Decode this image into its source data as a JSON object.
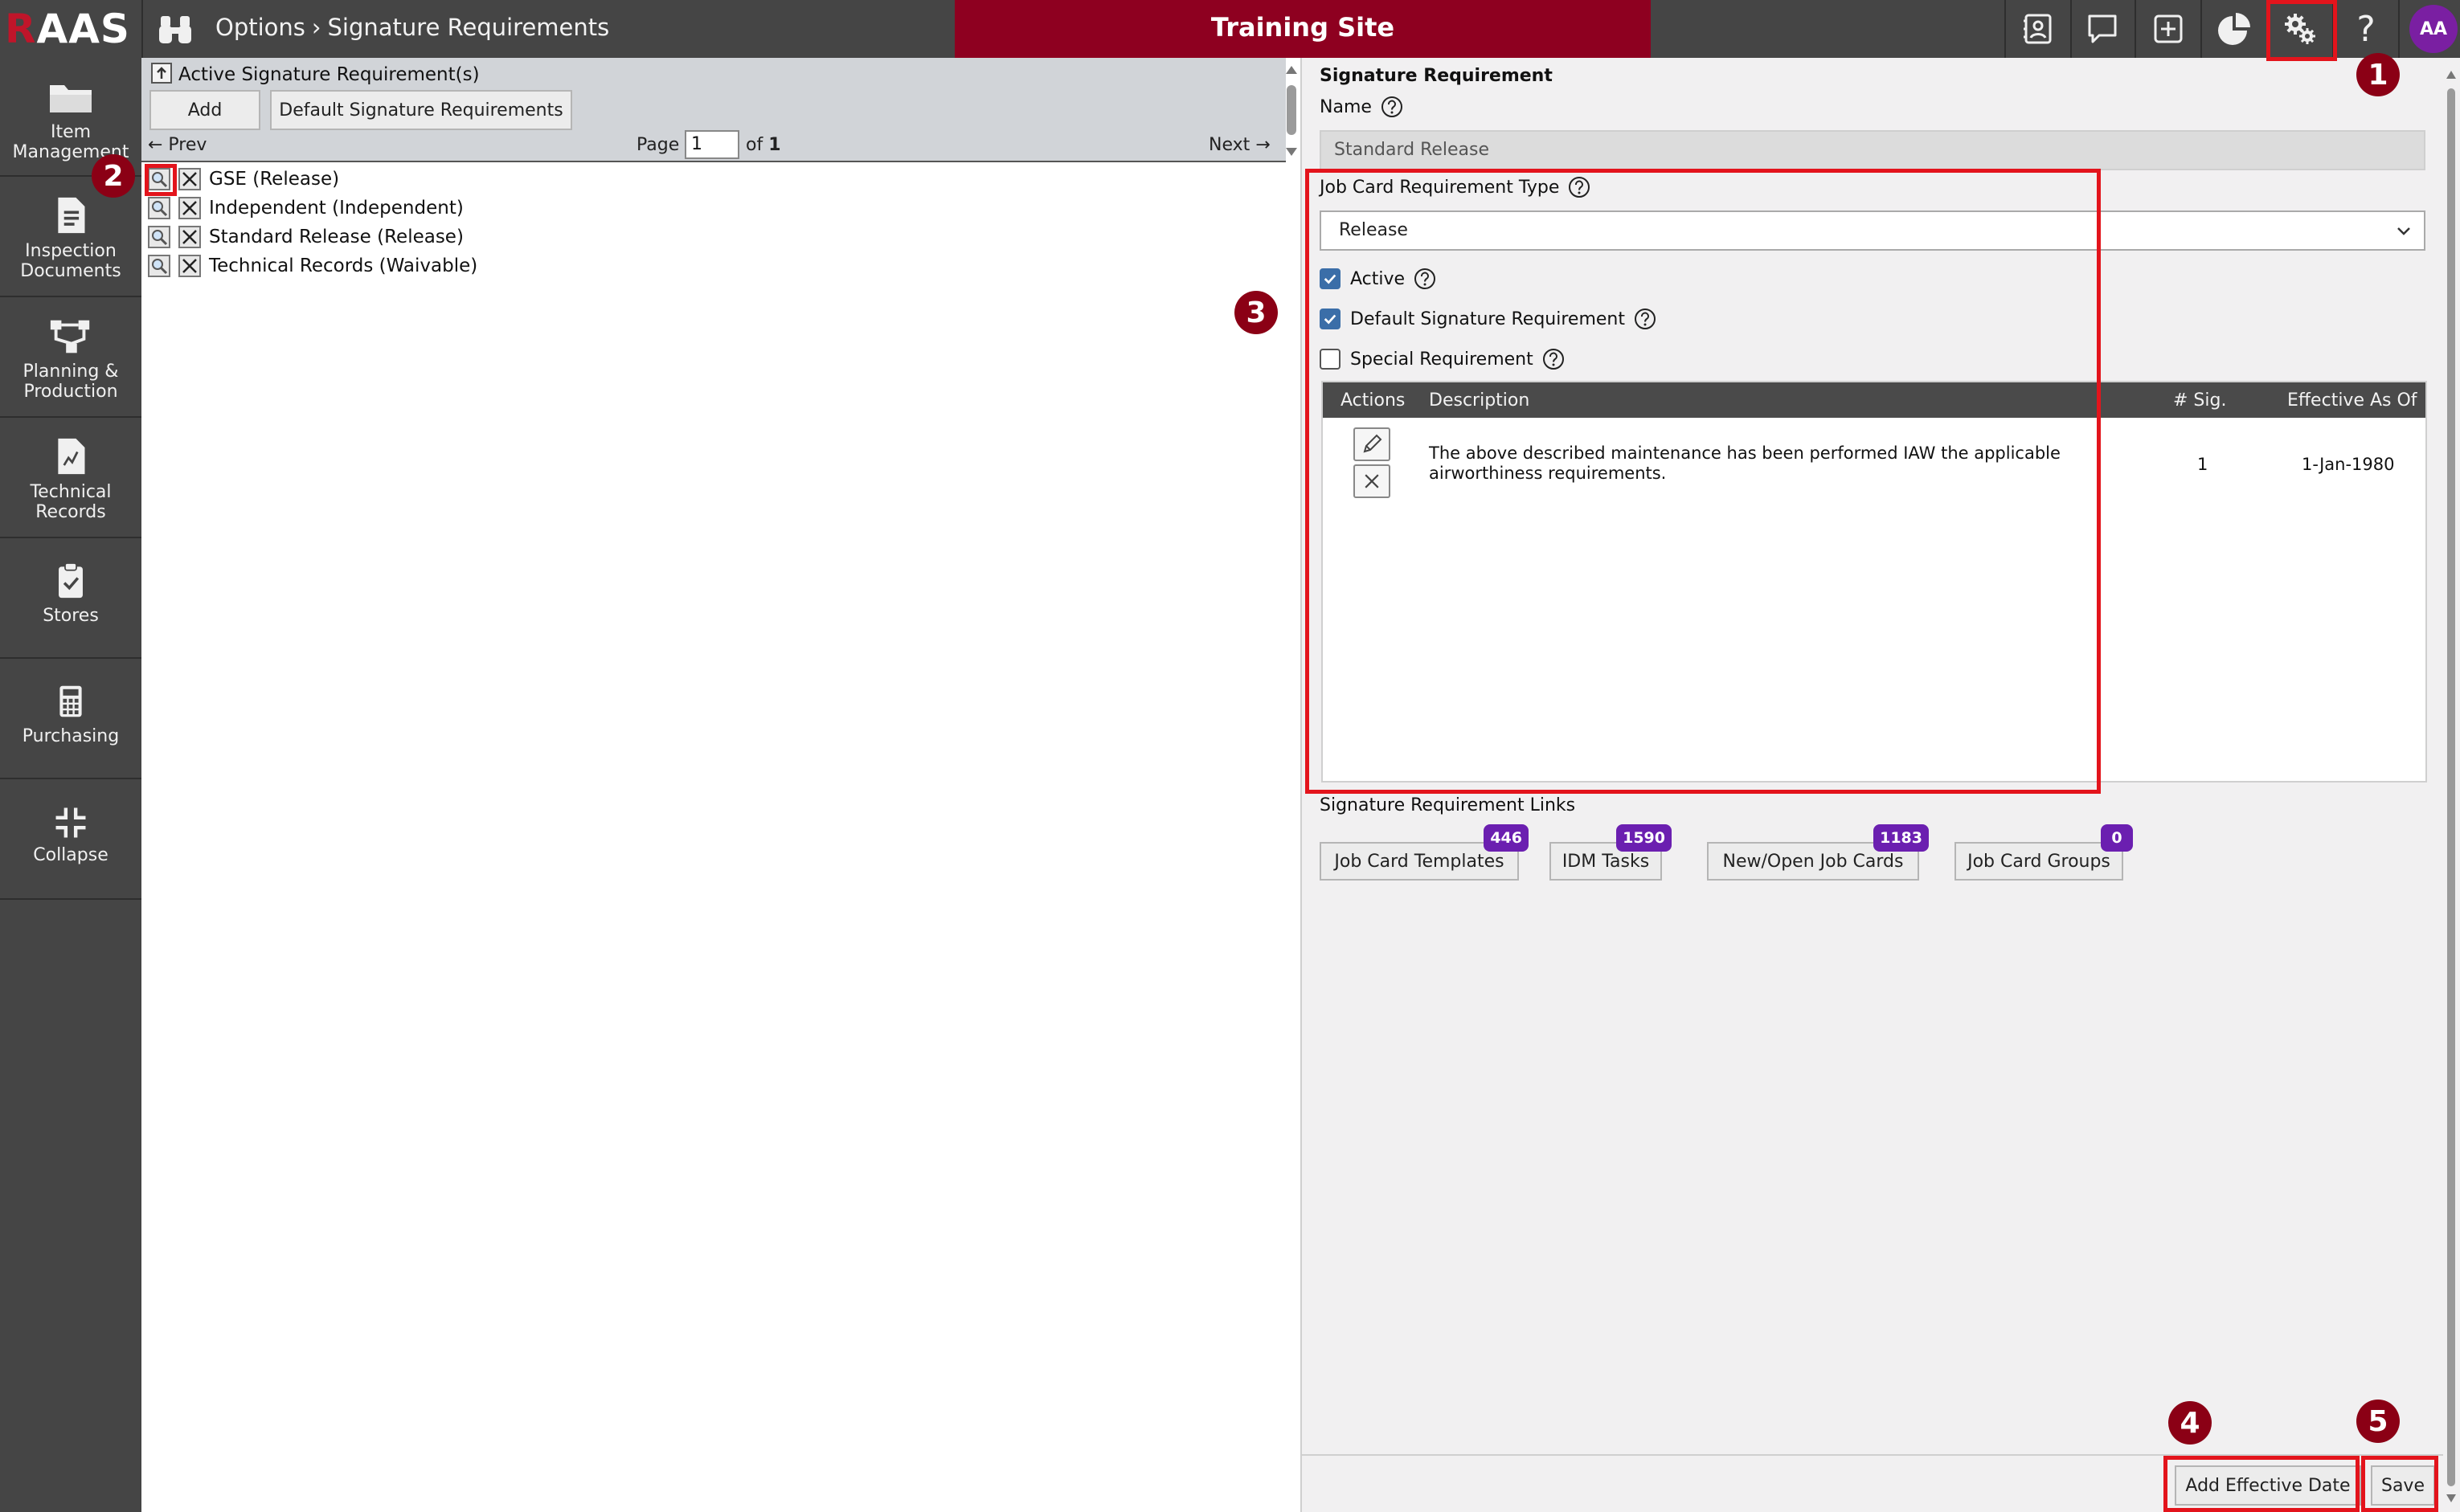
{
  "topbar": {
    "logo_r": "R",
    "logo_rest": "AAS",
    "breadcrumb_root": "Options",
    "breadcrumb_sep": "›",
    "breadcrumb_page": "Signature Requirements",
    "site_banner": "Training Site",
    "avatar_initials": "AA",
    "help_glyph": "?",
    "icons": [
      "binoculars-icon",
      "contact-card-icon",
      "chat-icon",
      "add-box-icon",
      "pie-chart-icon",
      "settings-gears-icon",
      "help-icon"
    ]
  },
  "sidebar": {
    "items": [
      {
        "label": "Item Management",
        "icon": "folder-icon"
      },
      {
        "label": "Inspection Documents",
        "icon": "document-icon"
      },
      {
        "label": "Planning & Production",
        "icon": "workflow-icon"
      },
      {
        "label": "Technical Records",
        "icon": "records-icon"
      },
      {
        "label": "Stores",
        "icon": "clipboard-check-icon"
      },
      {
        "label": "Purchasing",
        "icon": "calculator-icon"
      },
      {
        "label": "Collapse",
        "icon": "collapse-icon"
      }
    ]
  },
  "left_panel": {
    "title": "Active Signature Requirement(s)",
    "add_button": "Add",
    "default_button": "Default Signature Requirements",
    "pager": {
      "prev": "← Prev",
      "page_label": "Page",
      "page_value": "1",
      "of_label": "of",
      "total": "1",
      "next": "Next →"
    },
    "rows": [
      "GSE (Release)",
      "Independent (Independent)",
      "Standard Release (Release)",
      "Technical Records (Waivable)"
    ]
  },
  "detail": {
    "title": "Signature Requirement",
    "name_label": "Name",
    "name_value": "Standard Release",
    "type_label": "Job Card Requirement Type",
    "type_value": "Release",
    "active_label": "Active",
    "active_checked": true,
    "default_label": "Default Signature Requirement",
    "default_checked": true,
    "special_label": "Special Requirement",
    "special_checked": false,
    "table": {
      "headers": [
        "Actions",
        "Description",
        "# Sig.",
        "Effective As Of"
      ],
      "rows": [
        {
          "description": "The above described maintenance has been performed IAW the applicable airworthiness requirements.",
          "sig": "1",
          "effective": "1-Jan-1980"
        }
      ]
    },
    "links_title": "Signature Requirement Links",
    "links": [
      {
        "label": "Job Card Templates",
        "count": "446"
      },
      {
        "label": "IDM Tasks",
        "count": "1590"
      },
      {
        "label": "New/Open Job Cards",
        "count": "1183"
      },
      {
        "label": "Job Card Groups",
        "count": "0"
      }
    ],
    "add_effective_date_button": "Add Effective Date",
    "save_button": "Save"
  },
  "annotations": [
    "1",
    "2",
    "3",
    "4",
    "5"
  ],
  "colors": {
    "banner": "#8e0020",
    "chrome": "#454545",
    "badge": "#6b1fb0",
    "highlight": "#e3141c",
    "marker": "#8b0015",
    "checkbox": "#3b6ea8"
  }
}
